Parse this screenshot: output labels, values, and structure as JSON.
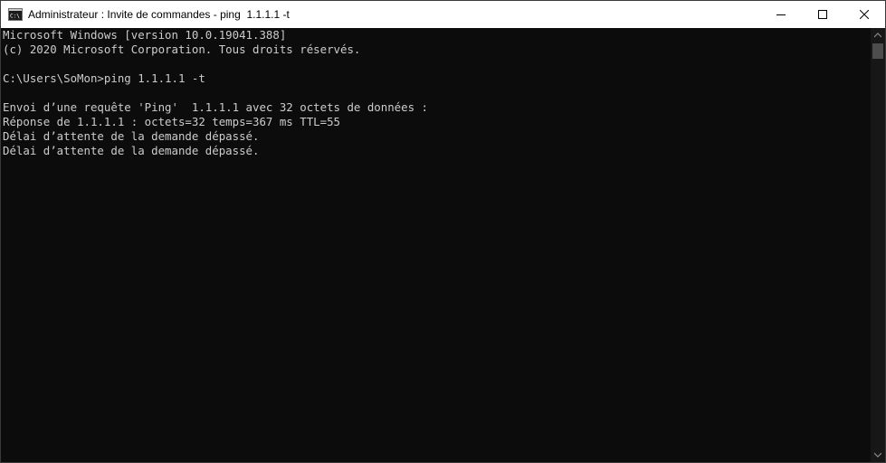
{
  "window": {
    "title": "Administrateur : Invite de commandes - ping  1.1.1.1 -t",
    "icon": "cmd-icon",
    "controls": {
      "minimize": "minimize-icon",
      "maximize": "maximize-icon",
      "close": "close-icon"
    }
  },
  "console": {
    "lines": [
      "Microsoft Windows [version 10.0.19041.388]",
      "(c) 2020 Microsoft Corporation. Tous droits réservés.",
      "",
      "C:\\Users\\SoMon>ping 1.1.1.1 -t",
      "",
      "Envoi d’une requête 'Ping'  1.1.1.1 avec 32 octets de données :",
      "Réponse de 1.1.1.1 : octets=32 temps=367 ms TTL=55",
      "Délai d’attente de la demande dépassé.",
      "Délai d’attente de la demande dépassé."
    ]
  },
  "colors": {
    "console_background": "#0c0c0c",
    "console_text": "#cccccc",
    "titlebar_background": "#ffffff"
  }
}
